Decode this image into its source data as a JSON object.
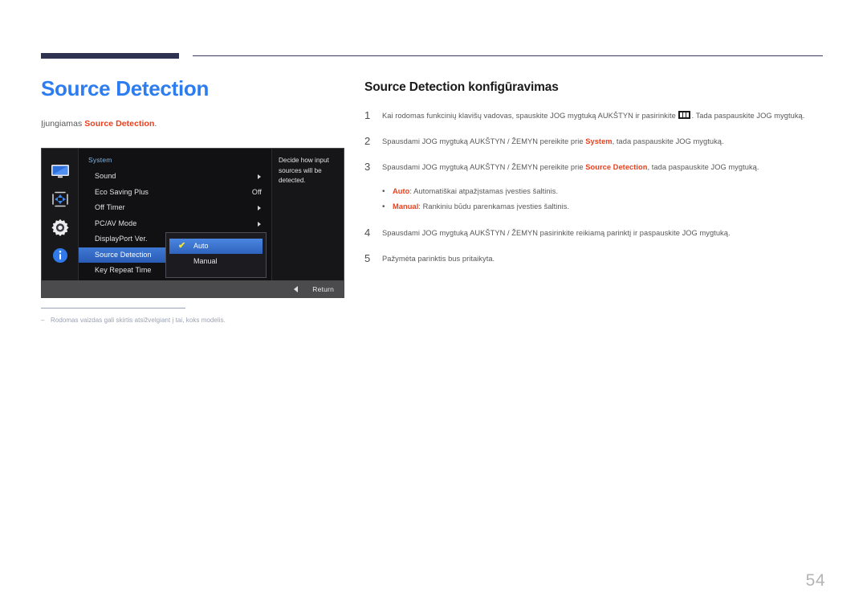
{
  "document": {
    "page_number": "54",
    "accent_blue": "#2d7df0",
    "accent_red": "#e8401f",
    "rule_navy": "#2e3150"
  },
  "left": {
    "title": "Source Detection",
    "intro_prefix": "Įjungiamas ",
    "intro_highlight": "Source Detection",
    "intro_suffix": ".",
    "footnote_dash": "‒",
    "footnote": "Rodomas vaizdas gali skirtis atsižvelgiant į tai, koks modelis."
  },
  "osd": {
    "category": "System",
    "rail_icons": [
      {
        "name": "monitor-icon"
      },
      {
        "name": "directional-pad-icon"
      },
      {
        "name": "gear-icon"
      },
      {
        "name": "info-icon"
      }
    ],
    "rows": [
      {
        "label": "Sound",
        "value": "",
        "arrow": true,
        "selected": false
      },
      {
        "label": "Eco Saving Plus",
        "value": "Off",
        "arrow": false,
        "selected": false
      },
      {
        "label": "Off Timer",
        "value": "",
        "arrow": true,
        "selected": false
      },
      {
        "label": "PC/AV Mode",
        "value": "",
        "arrow": true,
        "selected": false
      },
      {
        "label": "DisplayPort Ver.",
        "value": "",
        "arrow": false,
        "selected": false
      },
      {
        "label": "Source Detection",
        "value": "",
        "arrow": false,
        "selected": true
      },
      {
        "label": "Key Repeat Time",
        "value": "",
        "arrow": false,
        "selected": false
      }
    ],
    "submenu": [
      {
        "label": "Auto",
        "checked": true,
        "selected": true
      },
      {
        "label": "Manual",
        "checked": false,
        "selected": false
      }
    ],
    "check_mark": "✔",
    "description": "Decide how input sources will be detected.",
    "return_label": "Return"
  },
  "right": {
    "section_title": "Source Detection konfigūravimas",
    "steps": [
      {
        "num": "1",
        "text_before": "Kai rodomas funkcinių klavišų vadovas, spauskite JOG mygtuką AUKŠTYN ir pasirinkite ",
        "has_glyph": true,
        "text_after": ". Tada paspauskite JOG mygtuką."
      },
      {
        "num": "2",
        "text_before": "Spausdami JOG mygtuką AUKŠTYN / ŽEMYN pereikite prie ",
        "highlight": "System",
        "text_after": ", tada paspauskite JOG mygtuką."
      },
      {
        "num": "3",
        "text_before": "Spausdami JOG mygtuką AUKŠTYN / ŽEMYN pereikite prie ",
        "highlight": "Source Detection",
        "text_after": ", tada paspauskite JOG mygtuką."
      },
      {
        "num": "4",
        "text_before": "Spausdami JOG mygtuką AUKŠTYN / ŽEMYN pasirinkite reikiamą parinktį ir paspauskite JOG mygtuką.",
        "highlight": "",
        "text_after": ""
      },
      {
        "num": "5",
        "text_before": "Pažymėta parinktis bus pritaikyta.",
        "highlight": "",
        "text_after": ""
      }
    ],
    "bullets": [
      {
        "marker": "•",
        "term": "Auto",
        "text": ": Automatiškai atpažįstamas įvesties šaltinis."
      },
      {
        "marker": "•",
        "term": "Manual",
        "text": ": Rankiniu būdu parenkamas įvesties šaltinis."
      }
    ]
  }
}
